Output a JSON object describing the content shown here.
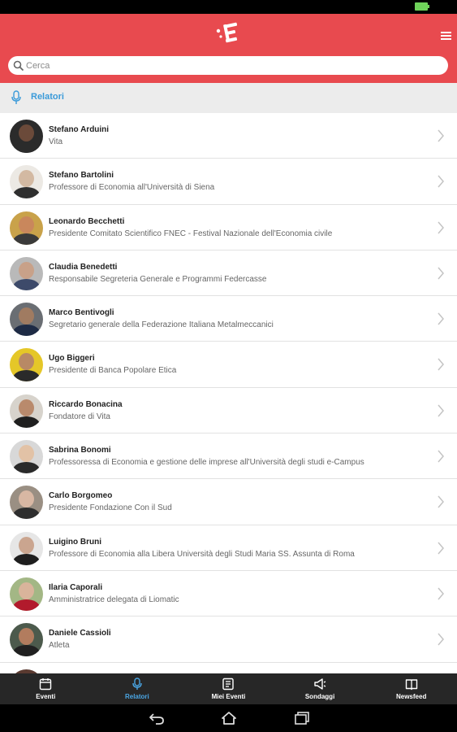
{
  "header": {
    "search_placeholder": "Cerca"
  },
  "section": {
    "title": "Relatori"
  },
  "speakers": [
    {
      "name": "Stefano Arduini",
      "role": "Vita"
    },
    {
      "name": "Stefano Bartolini",
      "role": "Professore di Economia all'Università di Siena"
    },
    {
      "name": "Leonardo Becchetti",
      "role": "Presidente Comitato Scientifico FNEC - Festival Nazionale dell'Economia civile"
    },
    {
      "name": "Claudia Benedetti",
      "role": "Responsabile Segreteria Generale e Programmi Federcasse"
    },
    {
      "name": "Marco Bentivogli",
      "role": "Segretario generale della Federazione Italiana Metalmeccanici"
    },
    {
      "name": "Ugo Biggeri",
      "role": "Presidente di Banca Popolare Etica"
    },
    {
      "name": "Riccardo Bonacina",
      "role": "Fondatore di Vita"
    },
    {
      "name": "Sabrina Bonomi",
      "role": "Professoressa di Economia e gestione delle imprese all'Università degli studi e-Campus"
    },
    {
      "name": "Carlo Borgomeo",
      "role": "Presidente Fondazione Con il Sud"
    },
    {
      "name": "Luigino Bruni",
      "role": "Professore di Economia alla Libera Università degli Studi Maria SS. Assunta di Roma"
    },
    {
      "name": "Ilaria Caporali",
      "role": "Amministratrice delegata di Liomatic"
    },
    {
      "name": "Daniele Cassioli",
      "role": "Atleta"
    }
  ],
  "tabs": [
    {
      "label": "Eventi",
      "icon": "calendar-icon"
    },
    {
      "label": "Relatori",
      "icon": "microphone-icon"
    },
    {
      "label": "Miei Eventi",
      "icon": "bookmark-list-icon"
    },
    {
      "label": "Sondaggi",
      "icon": "megaphone-icon"
    },
    {
      "label": "Newsfeed",
      "icon": "book-icon"
    }
  ],
  "colors": {
    "header": "#e84a4f",
    "accent": "#3a9ad9",
    "tabbar": "#272727"
  }
}
